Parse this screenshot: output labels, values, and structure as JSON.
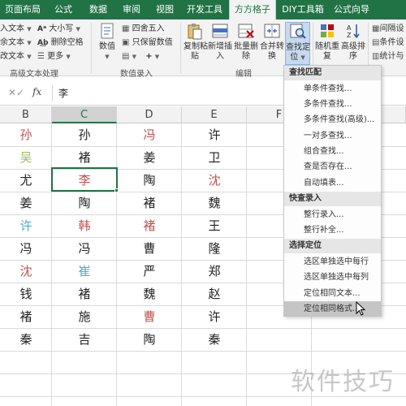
{
  "menubar": {
    "tabs": [
      "页面布局",
      "公式",
      "数据",
      "审阅",
      "视图",
      "开发工具",
      "方方格子",
      "DIY工具箱",
      "公式向导"
    ],
    "active_tab": "方方格子"
  },
  "ribbon": {
    "left_group": {
      "items": [
        "入文本",
        "余文本",
        "改文本"
      ],
      "col2": [
        "大小写",
        "删除空格",
        "更多"
      ],
      "label": "高级文本处理"
    },
    "numeric_group": {
      "numeric_label": "数值",
      "items": [
        "四舍五入",
        "只保留数值"
      ],
      "label": "数值录入"
    },
    "edit_group": {
      "buttons": [
        {
          "line1": "复制粘",
          "line2": "贴"
        },
        {
          "line1": "新增插",
          "line2": "入"
        },
        {
          "line1": "批量删",
          "line2": "除"
        },
        {
          "line1": "合并转",
          "line2": "换"
        },
        {
          "line1": "查找定",
          "line2": "位"
        }
      ],
      "label": "编辑"
    },
    "more_buttons": [
      {
        "line1": "随机重",
        "line2": "复"
      },
      {
        "line1": "高级排",
        "line2": "序"
      }
    ],
    "right_col": [
      "间隔设",
      "条件设",
      "统计与"
    ]
  },
  "formula_bar": {
    "value": "李"
  },
  "columns": [
    "B",
    "C",
    "D",
    "E",
    "F"
  ],
  "cells": [
    [
      {
        "t": "孙",
        "c": "#c0504d"
      },
      {
        "t": "孙",
        "c": "#222222"
      },
      {
        "t": "冯",
        "c": "#c0504d"
      },
      {
        "t": "许",
        "c": "#222222"
      }
    ],
    [
      {
        "t": "吴",
        "c": "#9bbb59"
      },
      {
        "t": "褚",
        "c": "#222222"
      },
      {
        "t": "姜",
        "c": "#222222"
      },
      {
        "t": "卫",
        "c": "#222222"
      }
    ],
    [
      {
        "t": "尤",
        "c": "#222222"
      },
      {
        "t": "李",
        "c": "#c0504d"
      },
      {
        "t": "陶",
        "c": "#222222"
      },
      {
        "t": "沈",
        "c": "#c0504d"
      }
    ],
    [
      {
        "t": "姜",
        "c": "#222222"
      },
      {
        "t": "陶",
        "c": "#222222"
      },
      {
        "t": "褚",
        "c": "#222222"
      },
      {
        "t": "魏",
        "c": "#222222"
      }
    ],
    [
      {
        "t": "许",
        "c": "#4bacc6"
      },
      {
        "t": "韩",
        "c": "#c0504d"
      },
      {
        "t": "褚",
        "c": "#c0504d"
      },
      {
        "t": "王",
        "c": "#222222"
      }
    ],
    [
      {
        "t": "冯",
        "c": "#222222"
      },
      {
        "t": "冯",
        "c": "#222222"
      },
      {
        "t": "曹",
        "c": "#222222"
      },
      {
        "t": "隆",
        "c": "#222222"
      }
    ],
    [
      {
        "t": "沈",
        "c": "#c0504d"
      },
      {
        "t": "崔",
        "c": "#4bacc6"
      },
      {
        "t": "严",
        "c": "#222222"
      },
      {
        "t": "郑",
        "c": "#222222"
      }
    ],
    [
      {
        "t": "钱",
        "c": "#222222"
      },
      {
        "t": "褚",
        "c": "#222222"
      },
      {
        "t": "魏",
        "c": "#222222"
      },
      {
        "t": "赵",
        "c": "#222222"
      }
    ],
    [
      {
        "t": "褚",
        "c": "#222222"
      },
      {
        "t": "施",
        "c": "#222222"
      },
      {
        "t": "曹",
        "c": "#c0504d"
      },
      {
        "t": "许",
        "c": "#222222"
      }
    ],
    [
      {
        "t": "秦",
        "c": "#222222"
      },
      {
        "t": "吉",
        "c": "#222222"
      },
      {
        "t": "陶",
        "c": "#222222"
      },
      {
        "t": "秦",
        "c": "#222222"
      }
    ]
  ],
  "dropdown": {
    "sections": [
      {
        "header": "查找匹配",
        "items": [
          "单条件查找...",
          "多条件查找...",
          "多条件查找(高级)...",
          "一对多查找...",
          "组合查找...",
          "查是否存在...",
          "自动填表..."
        ]
      },
      {
        "header": "快查录入",
        "items": [
          "整行录入...",
          "整行补全..."
        ]
      },
      {
        "header": "选择定位",
        "items": [
          "选区单独选中每行",
          "选区单独选中每列",
          "定位相同文本...",
          "定位相同格式..."
        ]
      }
    ],
    "hovered_item": "定位相同格式..."
  },
  "watermark": "软件技巧",
  "colors": {
    "accent": "#217346",
    "red": "#c0504d",
    "green": "#9bbb59",
    "teal": "#4bacc6"
  }
}
